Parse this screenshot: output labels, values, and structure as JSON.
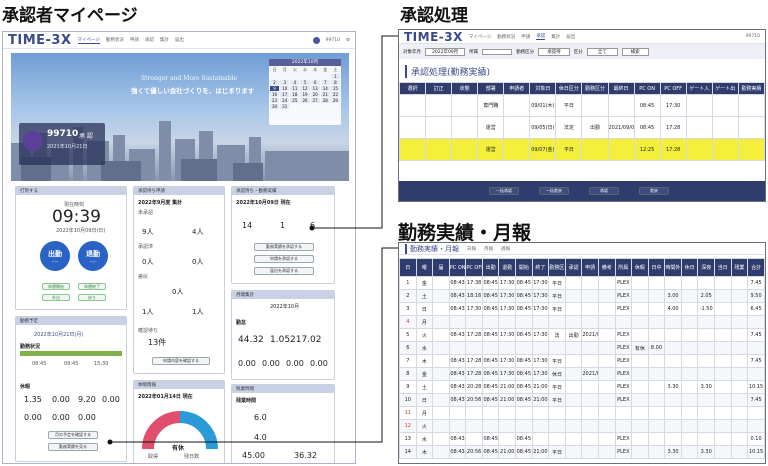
{
  "labels": {
    "mypage": "承認者マイページ",
    "approval": "承認処理",
    "monthly": "勤務実績・月報"
  },
  "app": {
    "logo": "TIME-3X",
    "user": "99710",
    "nav": [
      "マイページ",
      "勤務状況",
      "申請",
      "承認",
      "集計",
      "届出"
    ]
  },
  "hero": {
    "en": "Stronger and More Sustainable",
    "jp": "強くて優しい会社づくりを、はじまります",
    "user_id": "99710",
    "user_name": "承 認",
    "user_sub": "2021年10月21日",
    "calendar_title": "2022年10月",
    "calendar_days": [
      "日",
      "月",
      "火",
      "水",
      "木",
      "金",
      "土"
    ],
    "calendar_nums": [
      [
        "",
        "",
        "",
        "",
        "",
        "",
        "1"
      ],
      [
        "2",
        "3",
        "4",
        "5",
        "6",
        "7",
        "8"
      ],
      [
        "9",
        "10",
        "11",
        "12",
        "13",
        "14",
        "15"
      ],
      [
        "16",
        "17",
        "18",
        "19",
        "20",
        "21",
        "22"
      ],
      [
        "23",
        "24",
        "25",
        "26",
        "27",
        "28",
        "29"
      ],
      [
        "30",
        "31",
        "",
        "",
        "",
        "",
        ""
      ]
    ]
  },
  "stamp": {
    "title": "打刻する",
    "date": "現在時刻",
    "time": "09:39",
    "sub": "2022年10月09日(日)",
    "in": "出勤",
    "out": "退勤",
    "in_sub": "--:--",
    "out_sub": "--:--",
    "b1": "休憩開始",
    "b2": "休憩終了",
    "b3": "外出",
    "b4": "戻り"
  },
  "approve": {
    "title": "承認待ち申請",
    "period": "2022年9月度 集計",
    "r1l": "未承認",
    "r1a": "9人",
    "r1b": "4人",
    "r2l": "承認済",
    "r2a": "0人",
    "r2b": "0人",
    "r3l": "差戻",
    "r3v": "0人",
    "r4a": "1人",
    "r4b": "1人",
    "r5l": "確認待ち",
    "r5v": "13件",
    "btn": "申請内容を確認する"
  },
  "approve2": {
    "title": "承認待ち・勤務実績",
    "period": "2022年10月09日 現在",
    "c1": "14",
    "c2": "1",
    "c3": "6",
    "b1": "勤務実績を承認する",
    "b2": "申請を承認する",
    "b3": "届出を承認する"
  },
  "summary": {
    "title": "月間集計",
    "month": "2022年10月",
    "label": "勤怠",
    "v1": "44.32",
    "v2": "1.05",
    "v3": "217.02",
    "v4": "0.00",
    "v5": "0.00",
    "v6": "0.00",
    "v7": "0.00"
  },
  "schedule": {
    "title": "勤務予定",
    "date": "2022年10月21日(月)",
    "s1": "勤務状況",
    "times": [
      "08:45",
      "09:45",
      "15:30"
    ],
    "s2": "休暇",
    "n1": "1.35",
    "n2": "0.00",
    "n3": "9.20",
    "n4": "0.00",
    "n5": "0.00",
    "n6": "0.00",
    "n7": "0.00",
    "b1": "月の予定を確認する",
    "b2": "勤務実績を見る"
  },
  "leave": {
    "title": "休暇情報",
    "period": "2022年01月14日 現在",
    "center": "有休",
    "legend1": "取得",
    "legend2": "残日数"
  },
  "overtime": {
    "title": "残業時間",
    "label1": "残業時間",
    "v1": "6.0",
    "v2": "4.0",
    "v3": "45.00",
    "v4": "36.32"
  },
  "approval_screen": {
    "logo": "TIME-3X",
    "nav": [
      "マイページ",
      "勤務状況",
      "申請",
      "承認",
      "集計",
      "届出"
    ],
    "user": "99710",
    "filters": {
      "f1": "対象年月",
      "v1": "2022年09月",
      "f2": "所属",
      "f3": "勤務区分",
      "v3": "承認待",
      "f4": "区分",
      "v4": "全て",
      "btn": "検索"
    },
    "title": "承認処理(勤務実績)",
    "headers": [
      "選択",
      "訂正",
      "状態",
      "部署",
      "申請者",
      "対象日",
      "休日区分",
      "勤務区分",
      "最終日",
      "PC ON",
      "PC OFF",
      "ゲート入",
      "ゲート出",
      "勤務実績"
    ],
    "rows": [
      [
        "",
        "",
        "",
        "専門職",
        "",
        "09/01(木)",
        "平日",
        "",
        "",
        "08:45",
        "17:30",
        "",
        "",
        ""
      ],
      [
        "",
        "",
        "",
        "運営",
        "",
        "09/05(日)",
        "法定",
        "出勤",
        "2021/09/08",
        "08:45",
        "17:28",
        "",
        "",
        ""
      ],
      [
        "",
        "",
        "",
        "運営",
        "",
        "09/07(金)",
        "平日",
        "",
        "",
        "12:25",
        "17:28",
        "",
        "",
        ""
      ]
    ],
    "buttons": [
      "一括承認",
      "一括差戻",
      "承認",
      "差戻"
    ]
  },
  "monthly_screen": {
    "title": "勤務実績・月報",
    "tabs": [
      "日報",
      "月報",
      "週報"
    ],
    "headers": [
      "日",
      "曜",
      "届",
      "PC ON",
      "PC OFF",
      "出勤",
      "退勤",
      "開始",
      "終了",
      "勤務区分",
      "承認",
      "申請",
      "備考",
      "所属",
      "休暇",
      "日中",
      "時間外",
      "休日",
      "深夜",
      "当日",
      "残業",
      "合計"
    ],
    "rows": [
      [
        "1",
        "金",
        "",
        "08:43",
        "17:38",
        "08:45",
        "17:30",
        "08:45",
        "17:30",
        "平日",
        "",
        "",
        "",
        "PLEX",
        "",
        "",
        "",
        "",
        "",
        "",
        "",
        "7.45"
      ],
      [
        "2",
        "土",
        "",
        "08:43",
        "18:16",
        "08:45",
        "17:30",
        "08:45",
        "17:30",
        "平日",
        "",
        "",
        "",
        "PLEX",
        "",
        "",
        "3.00",
        "",
        "2.05",
        "",
        "",
        "9.50"
      ],
      [
        "3",
        "日",
        "",
        "08:43",
        "17:30",
        "08:45",
        "17:30",
        "08:45",
        "17:30",
        "平日",
        "",
        "",
        "",
        "PLEX",
        "",
        "",
        "4.00",
        "",
        "-1.50",
        "",
        "",
        "6.45"
      ],
      [
        "4",
        "月",
        "",
        "",
        "",
        "",
        "",
        "",
        "",
        "",
        "",
        "",
        "",
        "",
        "",
        "",
        "",
        "",
        "",
        "",
        "",
        ""
      ],
      [
        "5",
        "火",
        "",
        "08:43",
        "17:28",
        "08:45",
        "17:30",
        "08:45",
        "17:30",
        "法",
        "出勤",
        "2021/09/08",
        "",
        "PLEX",
        "",
        "",
        "",
        "",
        "",
        "",
        "",
        "7.45"
      ],
      [
        "6",
        "水",
        "",
        "",
        "",
        "",
        "",
        "",
        "",
        "",
        "",
        "",
        "",
        "PLEX",
        "有休",
        "8.00",
        "",
        "",
        "",
        "",
        "",
        ""
      ],
      [
        "7",
        "木",
        "",
        "08:43",
        "17:28",
        "08:45",
        "17:30",
        "08:45",
        "17:30",
        "平日",
        "",
        "",
        "",
        "PLEX",
        "",
        "",
        "",
        "",
        "",
        "",
        "",
        "7.45"
      ],
      [
        "8",
        "金",
        "",
        "08:43",
        "17:28",
        "08:45",
        "17:30",
        "08:45",
        "17:30",
        "休日",
        "",
        "2021/09/08",
        "",
        "PLEX",
        "",
        "",
        "",
        "",
        "",
        "",
        "",
        ""
      ],
      [
        "9",
        "土",
        "",
        "08:43",
        "20:28",
        "08:45",
        "21:00",
        "08:45",
        "21:00",
        "平日",
        "",
        "",
        "",
        "PLEX",
        "",
        "",
        "3.30",
        "",
        "3.30",
        "",
        "",
        "10.15"
      ],
      [
        "10",
        "日",
        "",
        "08:43",
        "20:56",
        "08:45",
        "21:00",
        "08:45",
        "21:00",
        "平日",
        "",
        "",
        "",
        "PLEX",
        "",
        "",
        "",
        "",
        "",
        "",
        "",
        "7.45"
      ],
      [
        "11",
        "月",
        "",
        "",
        "",
        "",
        "",
        "",
        "",
        "",
        "",
        "",
        "",
        "",
        "",
        "",
        "",
        "",
        "",
        "",
        "",
        ""
      ],
      [
        "12",
        "火",
        "",
        "",
        "",
        "",
        "",
        "",
        "",
        "",
        "",
        "",
        "",
        "",
        "",
        "",
        "",
        "",
        "",
        "",
        "",
        ""
      ],
      [
        "13",
        "水",
        "",
        "08:43",
        "",
        "08:45",
        "",
        "08:45",
        "",
        "",
        "",
        "",
        "",
        "PLEX",
        "",
        "",
        "",
        "",
        "",
        "",
        "",
        "0.10"
      ],
      [
        "14",
        "木",
        "",
        "08:43",
        "20:56",
        "08:45",
        "21:00",
        "08:45",
        "21:00",
        "平日",
        "",
        "",
        "",
        "PLEX",
        "",
        "",
        "3.30",
        "",
        "3.30",
        "",
        "",
        "10.15"
      ]
    ]
  }
}
